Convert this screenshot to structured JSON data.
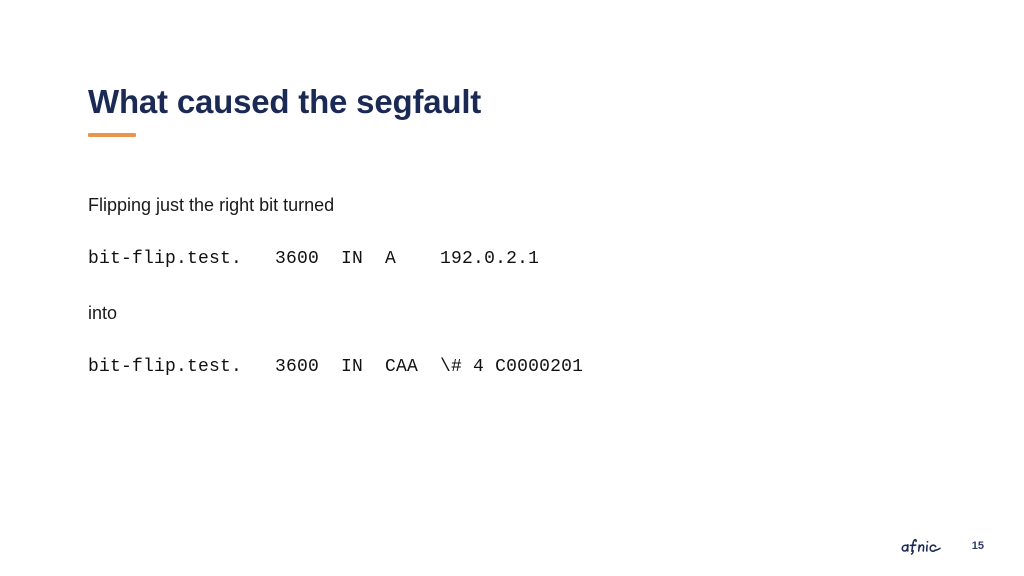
{
  "slide": {
    "title": "What caused the segfault",
    "accent_color": "#e8954e",
    "title_color": "#1b2a55",
    "background_color": "#ffffff",
    "body": {
      "intro_text": "Flipping just the right bit turned",
      "code_before": "bit-flip.test.   3600  IN  A    192.0.2.1",
      "connector_text": "into",
      "code_after": "bit-flip.test.   3600  IN  CAA  \\# 4 C0000201"
    },
    "footer": {
      "logo_name": "afnic",
      "page_number": "15"
    }
  }
}
